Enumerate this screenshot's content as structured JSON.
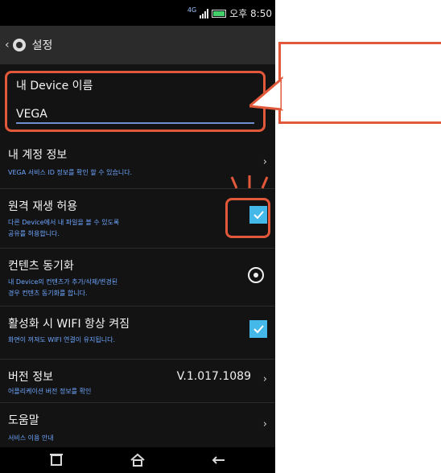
{
  "status": {
    "network": "4G",
    "time": "오후 8:50"
  },
  "header": {
    "back_icon": "chevron-left-icon",
    "icon": "gear-icon",
    "title": "설정"
  },
  "device_name": {
    "label": "내 Device 이름",
    "value": "VEGA"
  },
  "items": [
    {
      "title": "내 계정 정보",
      "subtitle": "VEGA 서비스 ID 정보를 확인 할 수 있습니다.",
      "control": "chevron-right-icon"
    },
    {
      "title": "원격 재생 허용",
      "subtitle_lines": [
        "다른 Device에서 내 파일을 볼 수 있도록",
        "공유를 허용합니다."
      ],
      "control": "checkbox",
      "checked": true
    },
    {
      "title": "컨텐츠 동기화",
      "subtitle_lines": [
        "내 Device의 컨텐츠가 추가/삭제/변경된",
        "경우 컨텐츠 동기화를 합니다."
      ],
      "control": "sync-icon"
    },
    {
      "title": "활성화 시 WIFI 항상 켜짐",
      "subtitle": "화면이 꺼져도 WIFI 연결이 유지됩니다.",
      "control": "checkbox",
      "checked": true
    },
    {
      "title": "버전 정보",
      "subtitle": "어플리케이션 버전 정보를 확인",
      "value": "V.1.017.1089",
      "control": "chevron-right-icon"
    },
    {
      "title": "도움말",
      "subtitle": "서비스 이용 안내",
      "control": "chevron-right-icon"
    }
  ],
  "navbar": {
    "left_icon": "recent-apps-icon",
    "center_icon": "home-icon",
    "right_icon": "back-icon"
  },
  "annotation_color": "#e2583b"
}
